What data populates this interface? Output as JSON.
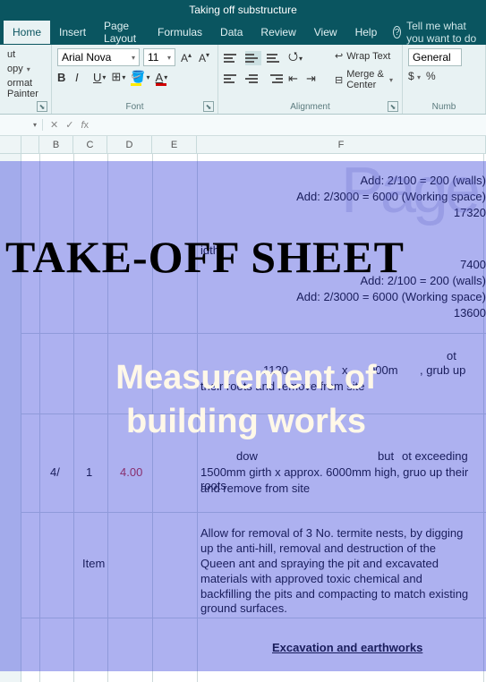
{
  "window": {
    "title": "Taking off substructure"
  },
  "tabs": [
    "Home",
    "Insert",
    "Page Layout",
    "Formulas",
    "Data",
    "Review",
    "View",
    "Help"
  ],
  "tellme": "Tell me what you want to do",
  "clipboard": {
    "cut": "ut",
    "copy": "opy",
    "painter": "ormat Painter"
  },
  "font": {
    "name": "Arial Nova",
    "size": "11",
    "group_label": "Font"
  },
  "alignment": {
    "wrap": "Wrap Text",
    "merge": "Merge & Center",
    "group_label": "Alignment"
  },
  "number": {
    "format": "General",
    "currency": "$",
    "percent": "%",
    "group_label": "Numb"
  },
  "cols": {
    "B": "B",
    "C": "C",
    "D": "D",
    "E": "E",
    "F": "F"
  },
  "cells": {
    "f1": "Add: 2/100 = 200 (walls)",
    "f2": "Add: 2/3000 = 6000 (Working space)",
    "f3": "17320",
    "f4_width": "idth",
    "f5": "7400",
    "f6": "Add: 2/100 = 200 (walls)",
    "f7": "Add: 2/3000 = 6000 (Working space)",
    "f8": "13600",
    "b1": "4/",
    "c1": "1",
    "d1": "4.00",
    "f_tree1a": "1120",
    "f_tree1b": "ot",
    "f_tree1c": "x.",
    "f_tree1d": "000m",
    "f_tree1e": ", grub up",
    "f_tree1f": "their roots and remove from site",
    "f_tree2a": "ot exceeding",
    "f_tree2b": "but",
    "f_tree2c": "dow",
    "f_tree2d": "1500mm girth x approx. 6000mm high, gruo up their roots",
    "f_tree2e": "and remove from site",
    "item_label": "Item",
    "f_termite": "Allow for removal of 3 No. termite nests, by digging up the anti-hill, removal and destruction of the Queen ant and spraying the pit and excavated materials with approved toxic chemical and backfilling the pits and compacting to match existing ground surfaces.",
    "f_heading": "Excavation and earthworks"
  },
  "overlay": {
    "title": "TAKE-OFF SHEET",
    "subtitle1": "Measurement of",
    "subtitle2": "building works",
    "page_ghost": "Page"
  }
}
